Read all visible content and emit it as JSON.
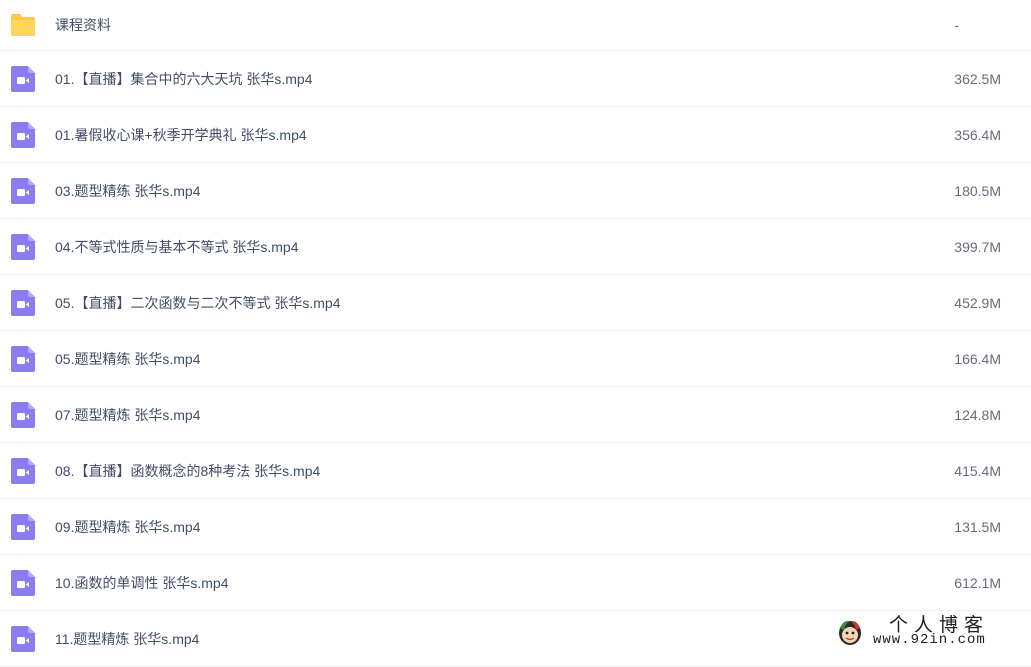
{
  "files": [
    {
      "name": "课程资料",
      "size": "-",
      "icon": "folder-icon"
    },
    {
      "name": "01.【直播】集合中的六大天坑 张华s.mp4",
      "size": "362.5M",
      "icon": "video-file-icon"
    },
    {
      "name": "01.暑假收心课+秋季开学典礼 张华s.mp4",
      "size": "356.4M",
      "icon": "video-file-icon"
    },
    {
      "name": "03.题型精练 张华s.mp4",
      "size": "180.5M",
      "icon": "video-file-icon"
    },
    {
      "name": "04.不等式性质与基本不等式 张华s.mp4",
      "size": "399.7M",
      "icon": "video-file-icon"
    },
    {
      "name": "05.【直播】二次函数与二次不等式 张华s.mp4",
      "size": "452.9M",
      "icon": "video-file-icon"
    },
    {
      "name": "05.题型精练 张华s.mp4",
      "size": "166.4M",
      "icon": "video-file-icon"
    },
    {
      "name": "07.题型精炼 张华s.mp4",
      "size": "124.8M",
      "icon": "video-file-icon"
    },
    {
      "name": "08.【直播】函数概念的8种考法 张华s.mp4",
      "size": "415.4M",
      "icon": "video-file-icon"
    },
    {
      "name": "09.题型精炼 张华s.mp4",
      "size": "131.5M",
      "icon": "video-file-icon"
    },
    {
      "name": "10.函数的单调性 张华s.mp4",
      "size": "612.1M",
      "icon": "video-file-icon"
    },
    {
      "name": "11.题型精炼 张华s.mp4",
      "size": "",
      "icon": "video-file-icon"
    }
  ],
  "watermark": {
    "title": "个人博客",
    "url": "www.92in.com"
  },
  "colors": {
    "folder": "#ffc940",
    "video": "#8b7cf0",
    "text": "#424e67",
    "size_text": "#666c7a",
    "divider": "#f1f2f5"
  }
}
